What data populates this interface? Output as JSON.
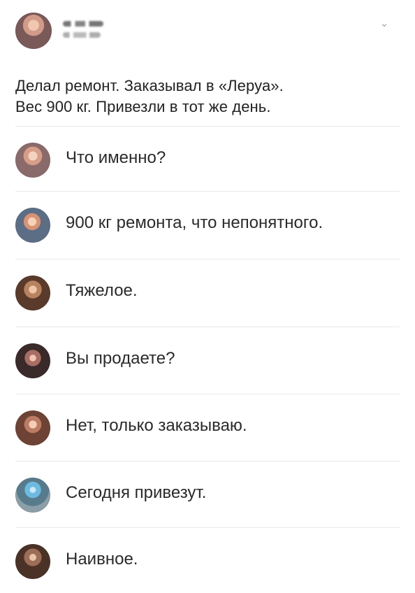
{
  "post": {
    "text_lines": [
      "Делал ремонт. Заказывал в «Леруа».",
      "Вес 900 кг. Привезли в тот же день."
    ]
  },
  "comments": [
    {
      "text": "Что именно?",
      "avatar_icon": "user-avatar-icon"
    },
    {
      "text": "900 кг ремонта, что непонятного.",
      "avatar_icon": "user-avatar-icon"
    },
    {
      "text": "Тяжелое.",
      "avatar_icon": "user-avatar-icon"
    },
    {
      "text": "Вы продаете?",
      "avatar_icon": "user-avatar-icon"
    },
    {
      "text": "Нет, только заказываю.",
      "avatar_icon": "user-avatar-icon"
    },
    {
      "text": "Сегодня привезут.",
      "avatar_icon": "user-avatar-icon"
    },
    {
      "text": "Наивное.",
      "avatar_icon": "user-avatar-icon"
    }
  ],
  "icons": {
    "more_menu": "chevron-down-icon"
  }
}
